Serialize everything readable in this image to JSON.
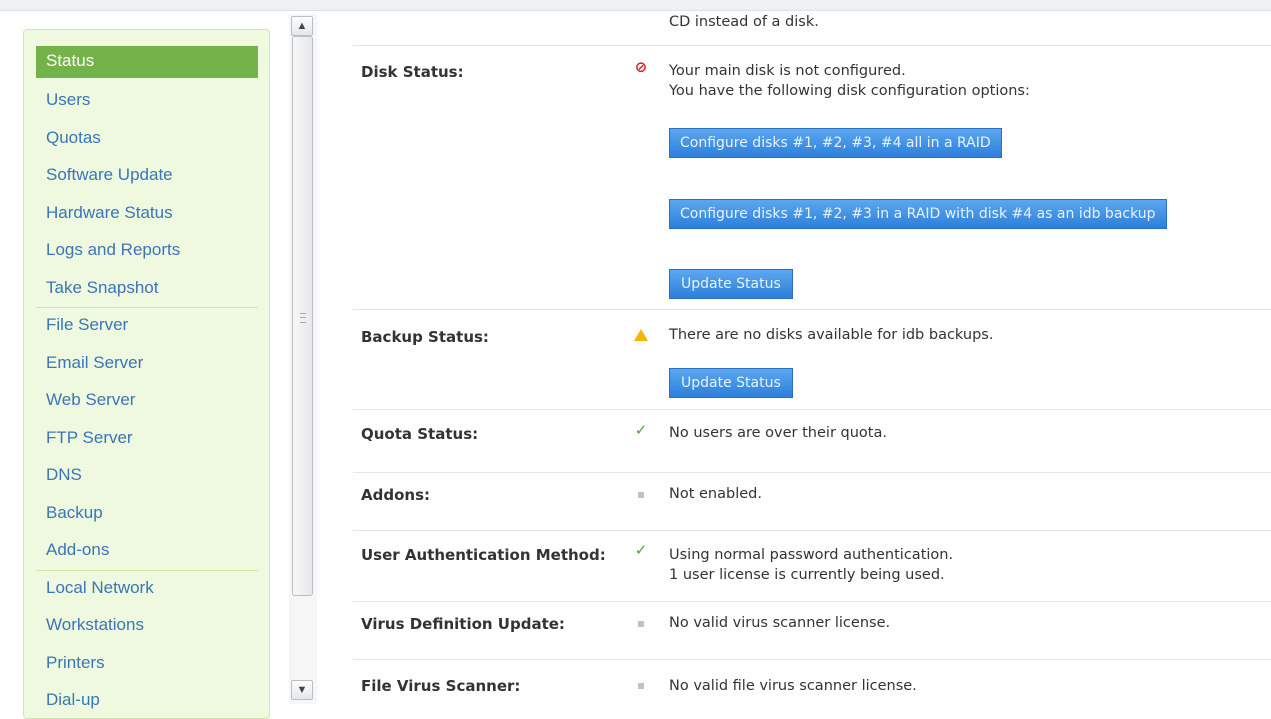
{
  "sidebar": {
    "items": [
      {
        "label": "Status"
      },
      {
        "label": "Users"
      },
      {
        "label": "Quotas"
      },
      {
        "label": "Software Update"
      },
      {
        "label": "Hardware Status"
      },
      {
        "label": "Logs and Reports"
      },
      {
        "label": "Take Snapshot"
      },
      {
        "label": "File Server"
      },
      {
        "label": "Email Server"
      },
      {
        "label": "Web Server"
      },
      {
        "label": "FTP Server"
      },
      {
        "label": "DNS"
      },
      {
        "label": "Backup"
      },
      {
        "label": "Add-ons"
      },
      {
        "label": "Local Network"
      },
      {
        "label": "Workstations"
      },
      {
        "label": "Printers"
      },
      {
        "label": "Dial-up"
      }
    ]
  },
  "scrollbar": {
    "up_icon": "up-arrow-icon",
    "down_icon": "down-arrow-icon"
  },
  "content": {
    "top_text": "CD instead of a disk.",
    "disk": {
      "label": "Disk Status:",
      "icon": "error-icon",
      "line1": "Your main disk is not configured.",
      "line2": "You have the following disk configuration options:",
      "btn1": "Configure disks #1, #2, #3, #4 all in a RAID",
      "btn2": "Configure disks #1, #2, #3 in a RAID with disk #4 as an idb backup",
      "btn3": "Update Status"
    },
    "backup": {
      "label": "Backup Status:",
      "icon": "warning-icon",
      "line1": "There are no disks available for idb backups.",
      "btn": "Update Status"
    },
    "quota": {
      "label": "Quota Status:",
      "icon": "check-icon",
      "line1": "No users are over their quota."
    },
    "addons": {
      "label": "Addons:",
      "icon": "bullet-icon",
      "line1": "Not enabled."
    },
    "auth": {
      "label": "User Authentication Method:",
      "icon": "check-icon",
      "line1": "Using normal password authentication.",
      "line2": "1 user license is currently being used."
    },
    "virusdef": {
      "label": "Virus Definition Update:",
      "icon": "bullet-icon",
      "line1": "No valid virus scanner license."
    },
    "filevirus": {
      "label": "File Virus Scanner:",
      "icon": "bullet-icon",
      "line1": "No valid file virus scanner license."
    }
  },
  "colors": {
    "active": "#73b34a",
    "link": "#3a75b8",
    "button": "#2b7fdb"
  }
}
